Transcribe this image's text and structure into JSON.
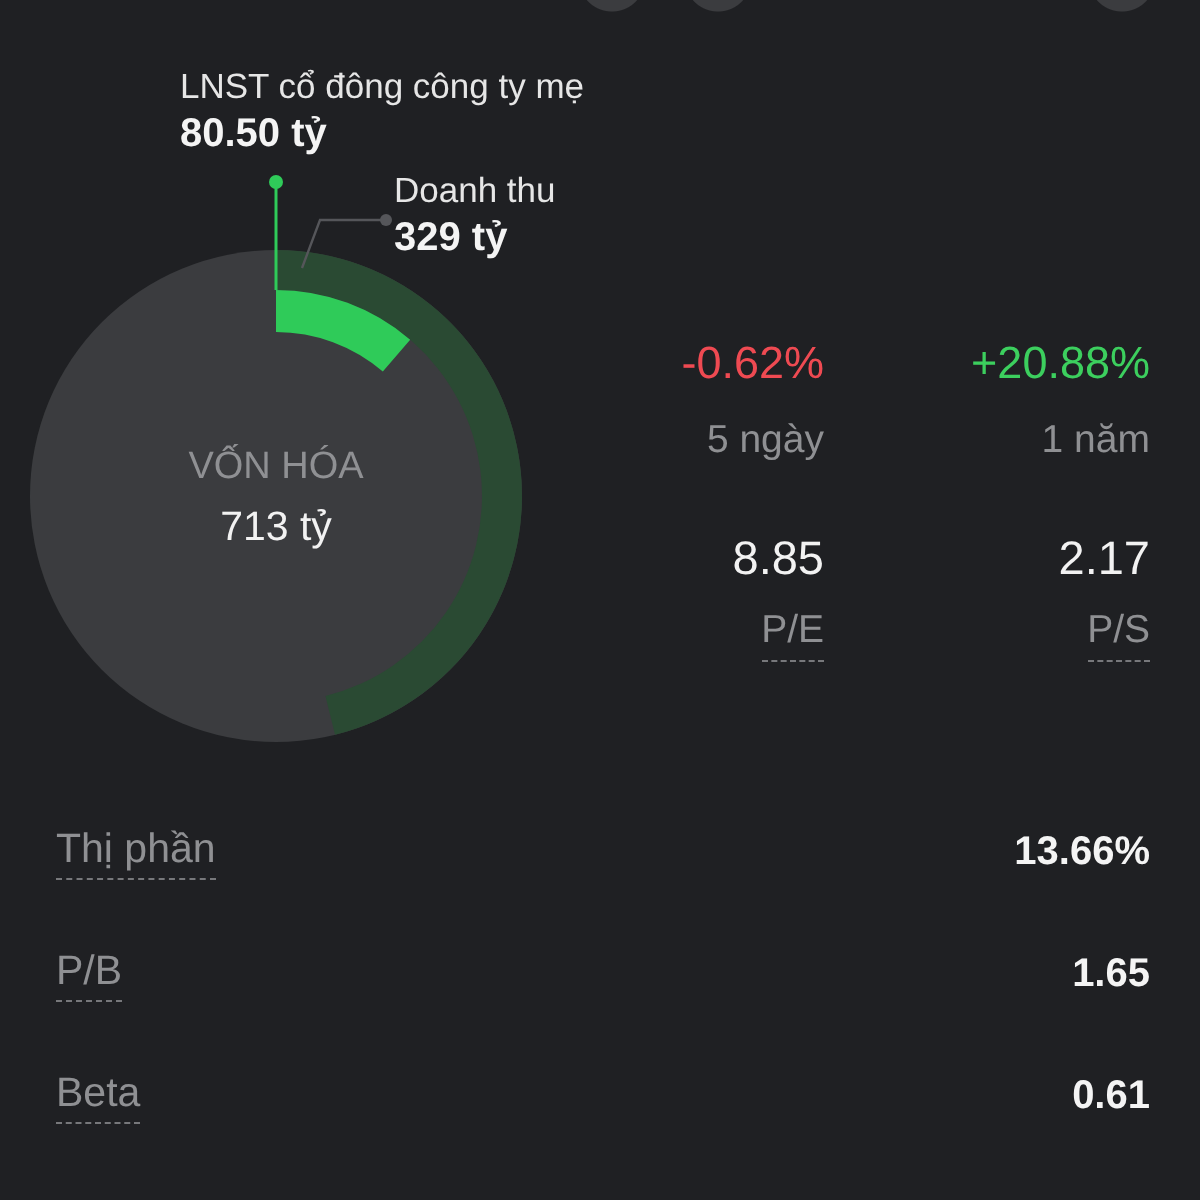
{
  "chart": {
    "center": {
      "label": "VỐN HÓA",
      "value": "713 tỷ"
    },
    "callouts": [
      {
        "kind": "profit",
        "label": "LNST cổ đông công ty mẹ",
        "value": "80.50 tỷ"
      },
      {
        "kind": "revenue",
        "label": "Doanh thu",
        "value": "329 tỷ"
      }
    ]
  },
  "changes": [
    {
      "value": "-0.62%",
      "period": "5 ngày",
      "color": "#ef4a52"
    },
    {
      "value": "+20.88%",
      "period": "1 năm",
      "color": "#3ccf5e"
    }
  ],
  "ratios": [
    {
      "value": "8.85",
      "label": "P/E"
    },
    {
      "value": "2.17",
      "label": "P/S"
    }
  ],
  "metrics": [
    {
      "label": "Thị phần",
      "value": "13.66%"
    },
    {
      "label": "P/B",
      "value": "1.65"
    },
    {
      "label": "Beta",
      "value": "0.61"
    }
  ]
}
